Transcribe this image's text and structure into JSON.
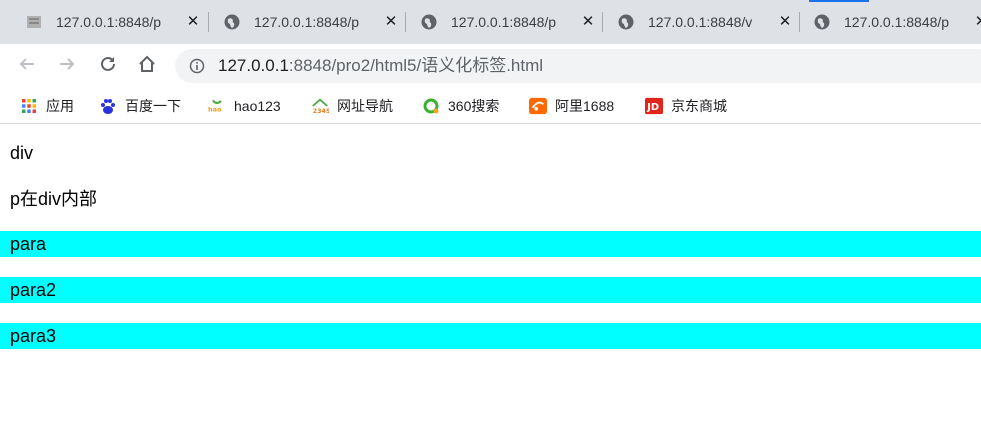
{
  "tabs": [
    {
      "title": "127.0.0.1:8848/p",
      "favicon": "page-icon"
    },
    {
      "title": "127.0.0.1:8848/p",
      "favicon": "globe-icon"
    },
    {
      "title": "127.0.0.1:8848/p",
      "favicon": "globe-icon"
    },
    {
      "title": "127.0.0.1:8848/v",
      "favicon": "globe-icon"
    },
    {
      "title": "127.0.0.1:8848/p",
      "favicon": "globe-icon"
    }
  ],
  "omnibox": {
    "host": "127.0.0.1",
    "path": ":8848/pro2/html5/语义化标签.html"
  },
  "bookmarks": [
    {
      "label": "应用",
      "icon": "apps-grid-icon"
    },
    {
      "label": "百度一下",
      "icon": "baidu-paw-icon"
    },
    {
      "label": "hao123",
      "icon": "hao123-icon"
    },
    {
      "label": "网址导航",
      "icon": "2345-house-icon"
    },
    {
      "label": "360搜索",
      "icon": "360-search-icon"
    },
    {
      "label": "阿里1688",
      "icon": "alibaba-1688-icon"
    },
    {
      "label": "京东商城",
      "icon": "jd-icon"
    }
  ],
  "page": {
    "div_text": "div",
    "p_in_div": "p在div内部",
    "paras": [
      "para",
      "para2",
      "para3"
    ],
    "para_background": "#00ffff"
  }
}
